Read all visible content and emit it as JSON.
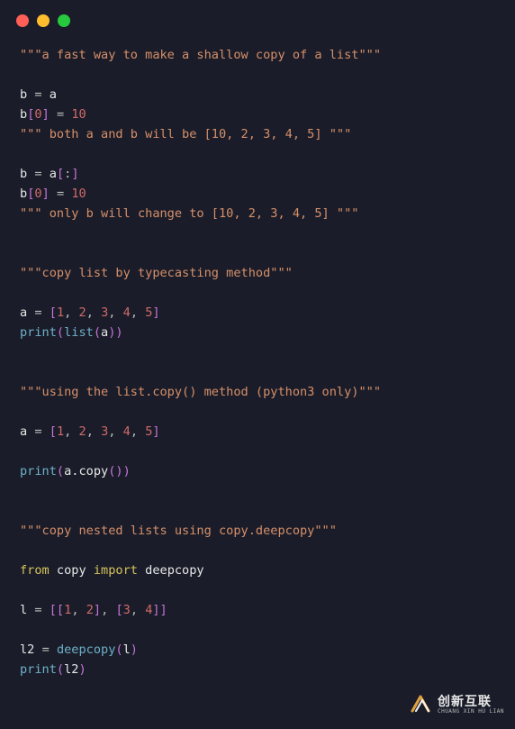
{
  "window": {
    "dots": [
      "red",
      "yellow",
      "green"
    ]
  },
  "code": {
    "lines": [
      [
        {
          "t": "\"\"\"a fast way to make a shallow copy of a list\"\"\"",
          "c": "c-str"
        }
      ],
      [],
      [
        {
          "t": "b ",
          "c": "c-var"
        },
        {
          "t": "= ",
          "c": "c-op"
        },
        {
          "t": "a",
          "c": "c-var"
        }
      ],
      [
        {
          "t": "b",
          "c": "c-var"
        },
        {
          "t": "[",
          "c": "c-par"
        },
        {
          "t": "0",
          "c": "c-num"
        },
        {
          "t": "] ",
          "c": "c-par"
        },
        {
          "t": "= ",
          "c": "c-op"
        },
        {
          "t": "10",
          "c": "c-num"
        }
      ],
      [
        {
          "t": "\"\"\" both a and b will be [10, 2, 3, 4, 5] \"\"\"",
          "c": "c-str"
        }
      ],
      [],
      [
        {
          "t": "b ",
          "c": "c-var"
        },
        {
          "t": "= ",
          "c": "c-op"
        },
        {
          "t": "a",
          "c": "c-var"
        },
        {
          "t": "[",
          "c": "c-par"
        },
        {
          "t": ":",
          "c": "c-op"
        },
        {
          "t": "]",
          "c": "c-par"
        }
      ],
      [
        {
          "t": "b",
          "c": "c-var"
        },
        {
          "t": "[",
          "c": "c-par"
        },
        {
          "t": "0",
          "c": "c-num"
        },
        {
          "t": "] ",
          "c": "c-par"
        },
        {
          "t": "= ",
          "c": "c-op"
        },
        {
          "t": "10",
          "c": "c-num"
        }
      ],
      [
        {
          "t": "\"\"\" only b will change to [10, 2, 3, 4, 5] \"\"\"",
          "c": "c-str"
        }
      ],
      [],
      [],
      [
        {
          "t": "\"\"\"copy list by typecasting method\"\"\"",
          "c": "c-str"
        }
      ],
      [],
      [
        {
          "t": "a ",
          "c": "c-var"
        },
        {
          "t": "= ",
          "c": "c-op"
        },
        {
          "t": "[",
          "c": "c-par"
        },
        {
          "t": "1",
          "c": "c-num"
        },
        {
          "t": ", ",
          "c": "c-op"
        },
        {
          "t": "2",
          "c": "c-num"
        },
        {
          "t": ", ",
          "c": "c-op"
        },
        {
          "t": "3",
          "c": "c-num"
        },
        {
          "t": ", ",
          "c": "c-op"
        },
        {
          "t": "4",
          "c": "c-num"
        },
        {
          "t": ", ",
          "c": "c-op"
        },
        {
          "t": "5",
          "c": "c-num"
        },
        {
          "t": "]",
          "c": "c-par"
        }
      ],
      [
        {
          "t": "print",
          "c": "c-fn"
        },
        {
          "t": "(",
          "c": "c-par"
        },
        {
          "t": "list",
          "c": "c-fn"
        },
        {
          "t": "(",
          "c": "c-par"
        },
        {
          "t": "a",
          "c": "c-var"
        },
        {
          "t": "))",
          "c": "c-par"
        }
      ],
      [],
      [],
      [
        {
          "t": "\"\"\"using the list.copy() method (python3 only)\"\"\"",
          "c": "c-str"
        }
      ],
      [],
      [
        {
          "t": "a ",
          "c": "c-var"
        },
        {
          "t": "= ",
          "c": "c-op"
        },
        {
          "t": "[",
          "c": "c-par"
        },
        {
          "t": "1",
          "c": "c-num"
        },
        {
          "t": ", ",
          "c": "c-op"
        },
        {
          "t": "2",
          "c": "c-num"
        },
        {
          "t": ", ",
          "c": "c-op"
        },
        {
          "t": "3",
          "c": "c-num"
        },
        {
          "t": ", ",
          "c": "c-op"
        },
        {
          "t": "4",
          "c": "c-num"
        },
        {
          "t": ", ",
          "c": "c-op"
        },
        {
          "t": "5",
          "c": "c-num"
        },
        {
          "t": "]",
          "c": "c-par"
        }
      ],
      [],
      [
        {
          "t": "print",
          "c": "c-fn"
        },
        {
          "t": "(",
          "c": "c-par"
        },
        {
          "t": "a.copy",
          "c": "c-var"
        },
        {
          "t": "())",
          "c": "c-par"
        }
      ],
      [],
      [],
      [
        {
          "t": "\"\"\"copy nested lists using copy.deepcopy\"\"\"",
          "c": "c-str"
        }
      ],
      [],
      [
        {
          "t": "from ",
          "c": "c-key"
        },
        {
          "t": "copy ",
          "c": "c-var"
        },
        {
          "t": "import ",
          "c": "c-key"
        },
        {
          "t": "deepcopy",
          "c": "c-var"
        }
      ],
      [],
      [
        {
          "t": "l ",
          "c": "c-var"
        },
        {
          "t": "= ",
          "c": "c-op"
        },
        {
          "t": "[[",
          "c": "c-par"
        },
        {
          "t": "1",
          "c": "c-num"
        },
        {
          "t": ", ",
          "c": "c-op"
        },
        {
          "t": "2",
          "c": "c-num"
        },
        {
          "t": "]",
          "c": "c-par"
        },
        {
          "t": ", ",
          "c": "c-op"
        },
        {
          "t": "[",
          "c": "c-par"
        },
        {
          "t": "3",
          "c": "c-num"
        },
        {
          "t": ", ",
          "c": "c-op"
        },
        {
          "t": "4",
          "c": "c-num"
        },
        {
          "t": "]]",
          "c": "c-par"
        }
      ],
      [],
      [
        {
          "t": "l2 ",
          "c": "c-var"
        },
        {
          "t": "= ",
          "c": "c-op"
        },
        {
          "t": "deepcopy",
          "c": "c-fn"
        },
        {
          "t": "(",
          "c": "c-par"
        },
        {
          "t": "l",
          "c": "c-var"
        },
        {
          "t": ")",
          "c": "c-par"
        }
      ],
      [
        {
          "t": "print",
          "c": "c-fn"
        },
        {
          "t": "(",
          "c": "c-par"
        },
        {
          "t": "l2",
          "c": "c-var"
        },
        {
          "t": ")",
          "c": "c-par"
        }
      ]
    ]
  },
  "watermark": {
    "zh": "创新互联",
    "en": "CHUANG XIN HU LIAN"
  }
}
